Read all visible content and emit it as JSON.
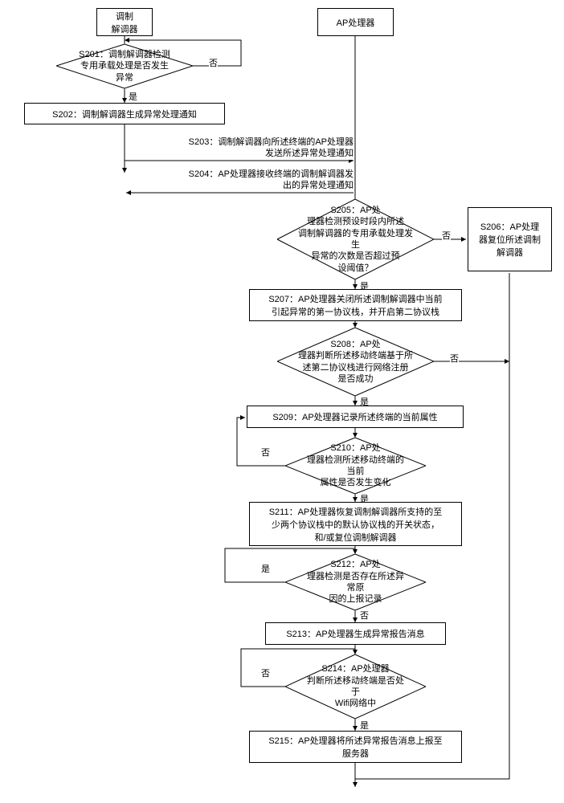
{
  "lanes": {
    "modem": "调制\n解调器",
    "ap": "AP处理器"
  },
  "steps": {
    "s201": "S201：调制解调器检测\n专用承载处理是否发生异常",
    "s202": "S202：调制解调器生成异常处理通知",
    "s203": "S203：调制解调器向所述终端的AP处理器\n发送所述异常处理通知",
    "s204": "S204：AP处理器接收终端的调制解调器发\n出的异常处理通知",
    "s205": "S205：AP处\n理器检测预设时段内所述\n调制解调器的专用承载处理发生\n异常的次数是否超过预\n设阈值？",
    "s206": "S206：AP处理\n器复位所述调制\n解调器",
    "s207": "S207：AP处理器关闭所述调制解调器中当前\n引起异常的第一协议栈，并开启第二协议栈",
    "s208": "S208：AP处\n理器判断所述移动终端基于所\n述第二协议栈进行网络注册\n是否成功",
    "s209": "S209：AP处理器记录所述终端的当前属性",
    "s210": "S210：AP处\n理器检测所述移动终端的当前\n属性是否发生变化",
    "s211": "S211：AP处理器恢复调制解调器所支持的至\n少两个协议栈中的默认协议栈的开关状态，\n和/或复位调制解调器",
    "s212": "S212：AP处\n理器检测是否存在所述异常原\n因的上报记录",
    "s213": "S213：AP处理器生成异常报告消息",
    "s214": "S214：AP处理器\n判断所述移动终端是否处于\nWifi网络中",
    "s215": "S215：AP处理器将所述异常报告消息上报至\n服务器"
  },
  "labels": {
    "yes": "是",
    "no": "否"
  }
}
